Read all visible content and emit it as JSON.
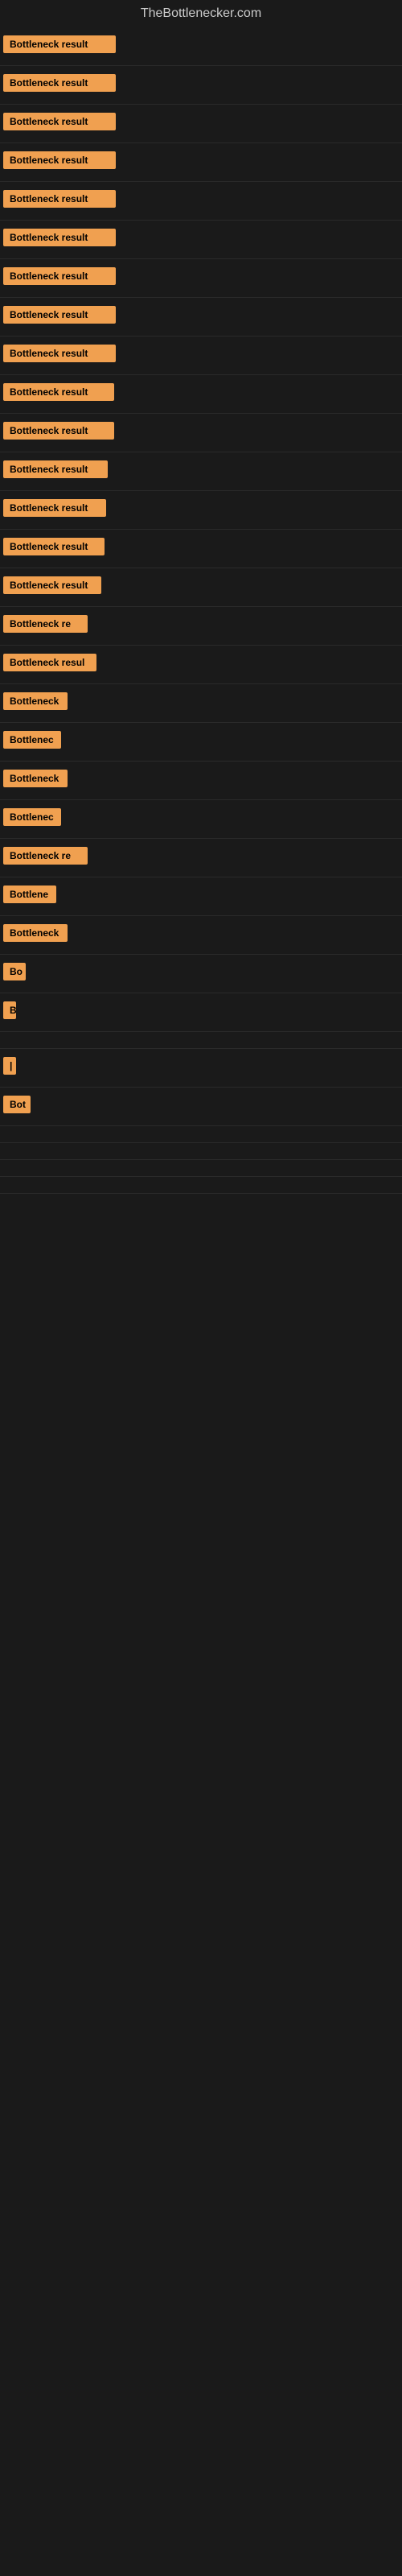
{
  "site": {
    "title": "TheBottlenecker.com"
  },
  "rows": [
    {
      "id": 1,
      "label": "Bottleneck result",
      "width": 140
    },
    {
      "id": 2,
      "label": "Bottleneck result",
      "width": 140
    },
    {
      "id": 3,
      "label": "Bottleneck result",
      "width": 140
    },
    {
      "id": 4,
      "label": "Bottleneck result",
      "width": 140
    },
    {
      "id": 5,
      "label": "Bottleneck result",
      "width": 140
    },
    {
      "id": 6,
      "label": "Bottleneck result",
      "width": 140
    },
    {
      "id": 7,
      "label": "Bottleneck result",
      "width": 140
    },
    {
      "id": 8,
      "label": "Bottleneck result",
      "width": 140
    },
    {
      "id": 9,
      "label": "Bottleneck result",
      "width": 140
    },
    {
      "id": 10,
      "label": "Bottleneck result",
      "width": 138
    },
    {
      "id": 11,
      "label": "Bottleneck result",
      "width": 138
    },
    {
      "id": 12,
      "label": "Bottleneck result",
      "width": 130
    },
    {
      "id": 13,
      "label": "Bottleneck result",
      "width": 128
    },
    {
      "id": 14,
      "label": "Bottleneck result",
      "width": 126
    },
    {
      "id": 15,
      "label": "Bottleneck result",
      "width": 122
    },
    {
      "id": 16,
      "label": "Bottleneck re",
      "width": 105
    },
    {
      "id": 17,
      "label": "Bottleneck resul",
      "width": 116
    },
    {
      "id": 18,
      "label": "Bottleneck",
      "width": 80
    },
    {
      "id": 19,
      "label": "Bottlenec",
      "width": 72
    },
    {
      "id": 20,
      "label": "Bottleneck",
      "width": 80
    },
    {
      "id": 21,
      "label": "Bottlenec",
      "width": 72
    },
    {
      "id": 22,
      "label": "Bottleneck re",
      "width": 105
    },
    {
      "id": 23,
      "label": "Bottlene",
      "width": 66
    },
    {
      "id": 24,
      "label": "Bottleneck",
      "width": 80
    },
    {
      "id": 25,
      "label": "Bo",
      "width": 28
    },
    {
      "id": 26,
      "label": "B",
      "width": 14
    },
    {
      "id": 27,
      "label": "",
      "width": 0
    },
    {
      "id": 28,
      "label": "|",
      "width": 8
    },
    {
      "id": 29,
      "label": "Bot",
      "width": 34
    },
    {
      "id": 30,
      "label": "",
      "width": 0
    },
    {
      "id": 31,
      "label": "",
      "width": 0
    },
    {
      "id": 32,
      "label": "",
      "width": 0
    },
    {
      "id": 33,
      "label": "",
      "width": 0
    }
  ]
}
